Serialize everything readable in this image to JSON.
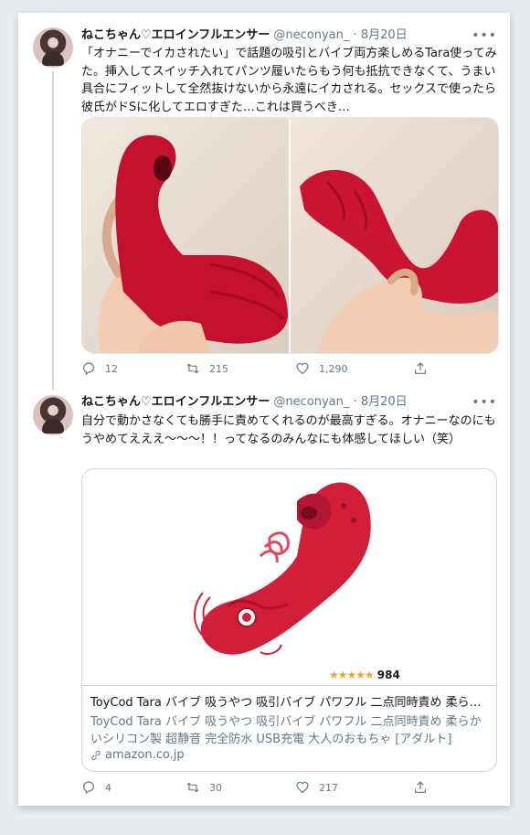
{
  "tweets": [
    {
      "name": "ねこちゃん♡エロインフルエンサー",
      "handle": "@neconyan_",
      "sep": "·",
      "date": "8月20日",
      "text": "「オナニーでイカされたい」で話題の吸引とバイブ両方楽しめるTara使ってみた。挿入してスイッチ入れてパンツ履いたらもう何も抵抗できなくて、うまい具合にフィットして全然抜けないから永遠にイカされる。セックスで使ったら彼氏がドSに化してエロすぎた…これは買うべき…",
      "replies": "12",
      "retweets": "215",
      "likes": "1,290"
    },
    {
      "name": "ねこちゃん♡エロインフルエンサー",
      "handle": "@neconyan_",
      "sep": "·",
      "date": "8月20日",
      "text": "自分で動かさなくても勝手に責めてくれるのが最高すぎる。オナニーなのにもうやめてえええ〜〜〜！！ってなるのみんなにも体感してほしい（笑）",
      "replies": "4",
      "retweets": "30",
      "likes": "217"
    }
  ],
  "product": {
    "rating_count": "984",
    "stars": "★★★★★",
    "title": "ToyCod Tara バイブ 吸うやつ 吸引バイブ パワフル 二点同時責め 柔ら…",
    "description": "ToyCod Tara バイブ 吸うやつ 吸引バイブ パワフル 二点同時責め 柔らかいシリコン製 超静音 完全防水 USB充電 大人のおもちゃ [アダルト]",
    "domain": "amazon.co.jp"
  },
  "icons": [
    "reply-icon",
    "retweet-icon",
    "like-icon",
    "share-icon",
    "more-icon",
    "link-icon"
  ],
  "colors": {
    "accent": "#1da1f2",
    "muted": "#657786",
    "product_red": "#d11f3a",
    "star": "#f4a623"
  }
}
